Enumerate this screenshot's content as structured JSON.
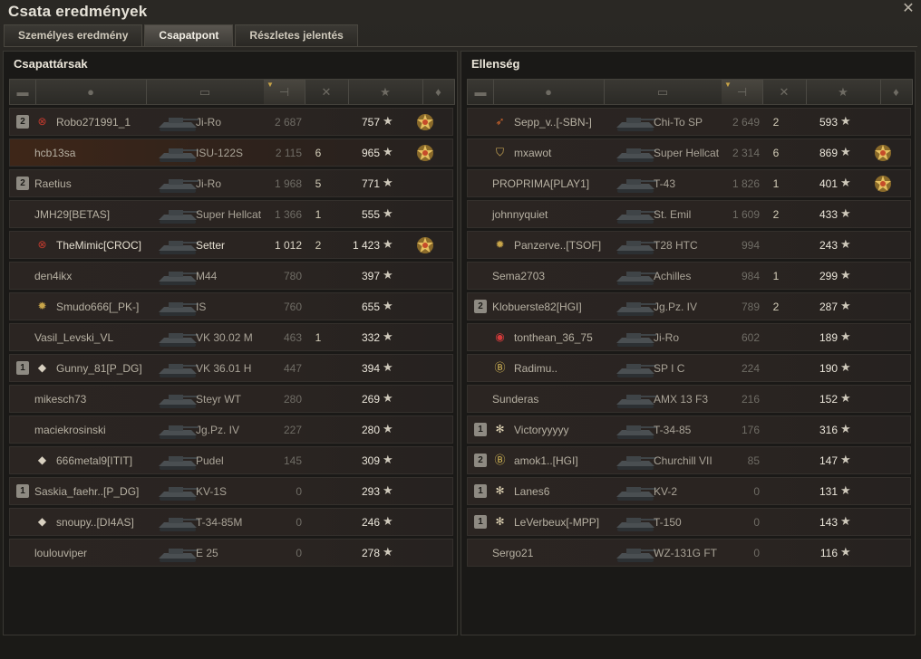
{
  "window": {
    "title": "Csata eredmények"
  },
  "tabs": [
    {
      "label": "Személyes eredmény",
      "active": false
    },
    {
      "label": "Csapatpont",
      "active": true
    },
    {
      "label": "Részletes jelentés",
      "active": false
    }
  ],
  "allies": {
    "title": "Csapattársak",
    "rows": [
      {
        "squad": "2",
        "clan_icon": "red-emblem",
        "name": "Robo271991_1",
        "vehicle": "Ji-Ro",
        "damage": "2 687",
        "kills": "",
        "xp": "757",
        "medal": true,
        "alive": false,
        "player": false
      },
      {
        "squad": "",
        "clan_icon": "",
        "name": "hcb13sa",
        "vehicle": "ISU-122S",
        "damage": "2 115",
        "kills": "6",
        "xp": "965",
        "medal": true,
        "alive": false,
        "player": true
      },
      {
        "squad": "2",
        "clan_icon": "",
        "name": "Raetius",
        "vehicle": "Ji-Ro",
        "damage": "1 968",
        "kills": "5",
        "xp": "771",
        "medal": false,
        "alive": false,
        "player": false
      },
      {
        "squad": "",
        "clan_icon": "",
        "name": "JMH29[BETAS]",
        "vehicle": "Super Hellcat",
        "damage": "1 366",
        "kills": "1",
        "xp": "555",
        "medal": false,
        "alive": false,
        "player": false
      },
      {
        "squad": "",
        "clan_icon": "red-emblem",
        "name": "TheMimic[CROC]",
        "vehicle": "Setter",
        "damage": "1 012",
        "kills": "2",
        "xp": "1 423",
        "medal": true,
        "alive": true,
        "player": false
      },
      {
        "squad": "",
        "clan_icon": "",
        "name": "den4ikx",
        "vehicle": "M44",
        "damage": "780",
        "kills": "",
        "xp": "397",
        "medal": false,
        "alive": false,
        "player": false
      },
      {
        "squad": "",
        "clan_icon": "gear-emblem",
        "name": "Smudo666[_PK-]",
        "vehicle": "IS",
        "damage": "760",
        "kills": "",
        "xp": "655",
        "medal": false,
        "alive": false,
        "player": false
      },
      {
        "squad": "",
        "clan_icon": "",
        "name": "Vasil_Levski_VL",
        "vehicle": "VK 30.02 M",
        "damage": "463",
        "kills": "1",
        "xp": "332",
        "medal": false,
        "alive": false,
        "player": false
      },
      {
        "squad": "1",
        "clan_icon": "diamond-emblem",
        "name": "Gunny_81[P_DG]",
        "vehicle": "VK 36.01 H",
        "damage": "447",
        "kills": "",
        "xp": "394",
        "medal": false,
        "alive": false,
        "player": false
      },
      {
        "squad": "",
        "clan_icon": "",
        "name": "mikesch73",
        "vehicle": "Steyr WT",
        "damage": "280",
        "kills": "",
        "xp": "269",
        "medal": false,
        "alive": false,
        "player": false
      },
      {
        "squad": "",
        "clan_icon": "",
        "name": "maciekrosinski",
        "vehicle": "Jg.Pz. IV",
        "damage": "227",
        "kills": "",
        "xp": "280",
        "medal": false,
        "alive": false,
        "player": false
      },
      {
        "squad": "",
        "clan_icon": "diamond-emblem",
        "name": "666metal9[ITIT]",
        "vehicle": "Pudel",
        "damage": "145",
        "kills": "",
        "xp": "309",
        "medal": false,
        "alive": false,
        "player": false
      },
      {
        "squad": "1",
        "clan_icon": "",
        "name": "Saskia_faehr..[P_DG]",
        "vehicle": "KV-1S",
        "damage": "0",
        "kills": "",
        "xp": "293",
        "medal": false,
        "alive": false,
        "player": false
      },
      {
        "squad": "",
        "clan_icon": "diamond-emblem",
        "name": "snoupy..[DI4AS]",
        "vehicle": "T-34-85M",
        "damage": "0",
        "kills": "",
        "xp": "246",
        "medal": false,
        "alive": false,
        "player": false
      },
      {
        "squad": "",
        "clan_icon": "",
        "name": "loulouviper",
        "vehicle": "E 25",
        "damage": "0",
        "kills": "",
        "xp": "278",
        "medal": false,
        "alive": false,
        "player": false
      }
    ]
  },
  "enemies": {
    "title": "Ellenség",
    "rows": [
      {
        "squad": "",
        "clan_icon": "wing-emblem",
        "name": "Sepp_v..[-SBN-]",
        "vehicle": "Chi-To SP",
        "damage": "2 649",
        "kills": "2",
        "xp": "593",
        "medal": false
      },
      {
        "squad": "",
        "clan_icon": "shield-emblem",
        "name": "mxawot",
        "vehicle": "Super Hellcat",
        "damage": "2 314",
        "kills": "6",
        "xp": "869",
        "medal": true
      },
      {
        "squad": "",
        "clan_icon": "",
        "name": "PROPRIMA[PLAY1]",
        "vehicle": "T-43",
        "damage": "1 826",
        "kills": "1",
        "xp": "401",
        "medal": true
      },
      {
        "squad": "",
        "clan_icon": "",
        "name": "johnnyquiet",
        "vehicle": "St. Emil",
        "damage": "1 609",
        "kills": "2",
        "xp": "433",
        "medal": false
      },
      {
        "squad": "",
        "clan_icon": "gear-emblem",
        "name": "Panzerve..[TSOF]",
        "vehicle": "T28 HTC",
        "damage": "994",
        "kills": "",
        "xp": "243",
        "medal": false
      },
      {
        "squad": "",
        "clan_icon": "",
        "name": "Sema2703",
        "vehicle": "Achilles",
        "damage": "984",
        "kills": "1",
        "xp": "299",
        "medal": false
      },
      {
        "squad": "2",
        "clan_icon": "",
        "name": "Klobuerste82[HGI]",
        "vehicle": "Jg.Pz. IV",
        "damage": "789",
        "kills": "2",
        "xp": "287",
        "medal": false
      },
      {
        "squad": "",
        "clan_icon": "red-circle-emblem",
        "name": "tonthean_36_75",
        "vehicle": "Ji-Ro",
        "damage": "602",
        "kills": "",
        "xp": "189",
        "medal": false
      },
      {
        "squad": "",
        "clan_icon": "b-emblem",
        "name": "Radimu..",
        "vehicle": "SP I C",
        "damage": "224",
        "kills": "",
        "xp": "190",
        "medal": false
      },
      {
        "squad": "",
        "clan_icon": "",
        "name": "Sunderas",
        "vehicle": "AMX 13 F3",
        "damage": "216",
        "kills": "",
        "xp": "152",
        "medal": false
      },
      {
        "squad": "1",
        "clan_icon": "snowflake-emblem",
        "name": "Victoryyyyy",
        "vehicle": "T-34-85",
        "damage": "176",
        "kills": "",
        "xp": "316",
        "medal": false
      },
      {
        "squad": "2",
        "clan_icon": "b-emblem",
        "name": "amok1..[HGI]",
        "vehicle": "Churchill VII",
        "damage": "85",
        "kills": "",
        "xp": "147",
        "medal": false
      },
      {
        "squad": "1",
        "clan_icon": "snowflake-emblem",
        "name": "Lanes6",
        "vehicle": "KV-2",
        "damage": "0",
        "kills": "",
        "xp": "131",
        "medal": false
      },
      {
        "squad": "1",
        "clan_icon": "snowflake-emblem",
        "name": "LeVerbeux[-MPP]",
        "vehicle": "T-150",
        "damage": "0",
        "kills": "",
        "xp": "143",
        "medal": false
      },
      {
        "squad": "",
        "clan_icon": "",
        "name": "Sergo21",
        "vehicle": "WZ-131G FT",
        "damage": "0",
        "kills": "",
        "xp": "116",
        "medal": false
      }
    ]
  },
  "columns": [
    {
      "icon": "squad-icon"
    },
    {
      "icon": "player-icon"
    },
    {
      "icon": "tank-icon"
    },
    {
      "icon": "damage-icon",
      "sorted": true
    },
    {
      "icon": "kills-icon"
    },
    {
      "icon": "xp-star-icon"
    },
    {
      "icon": "medal-icon"
    }
  ],
  "colors": {
    "accent": "#c7a347",
    "player_row": "#3e2618"
  }
}
